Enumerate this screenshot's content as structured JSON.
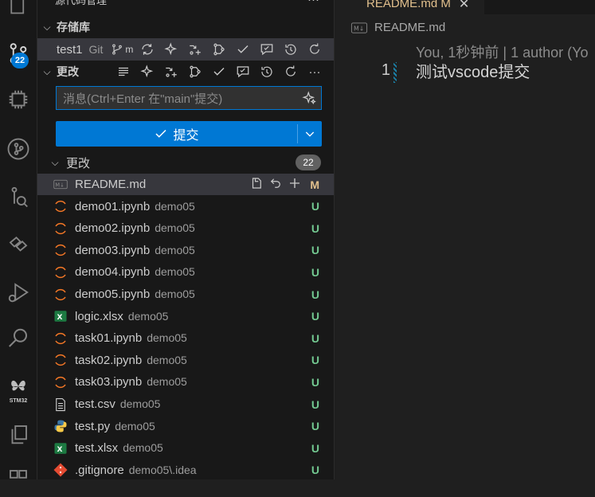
{
  "sidebar": {
    "top_title": "源代码管理",
    "repos_header": "存储库",
    "repo": {
      "name": "test1",
      "type": "Git",
      "branch": "m"
    },
    "changes_section": "更改",
    "commit_input": {
      "placeholder": "消息(Ctrl+Enter 在\"main\"提交)",
      "value": ""
    },
    "commit_button": "提交",
    "changes_group": {
      "label": "更改",
      "count": "22"
    },
    "files": [
      {
        "name": "README.md",
        "dir": "",
        "status": "M",
        "icon": "markdown-icon"
      },
      {
        "name": "demo01.ipynb",
        "dir": "demo05",
        "status": "U",
        "icon": "jupyter-icon"
      },
      {
        "name": "demo02.ipynb",
        "dir": "demo05",
        "status": "U",
        "icon": "jupyter-icon"
      },
      {
        "name": "demo03.ipynb",
        "dir": "demo05",
        "status": "U",
        "icon": "jupyter-icon"
      },
      {
        "name": "demo04.ipynb",
        "dir": "demo05",
        "status": "U",
        "icon": "jupyter-icon"
      },
      {
        "name": "demo05.ipynb",
        "dir": "demo05",
        "status": "U",
        "icon": "jupyter-icon"
      },
      {
        "name": "logic.xlsx",
        "dir": "demo05",
        "status": "U",
        "icon": "excel-icon"
      },
      {
        "name": "task01.ipynb",
        "dir": "demo05",
        "status": "U",
        "icon": "jupyter-icon"
      },
      {
        "name": "task02.ipynb",
        "dir": "demo05",
        "status": "U",
        "icon": "jupyter-icon"
      },
      {
        "name": "task03.ipynb",
        "dir": "demo05",
        "status": "U",
        "icon": "jupyter-icon"
      },
      {
        "name": "test.csv",
        "dir": "demo05",
        "status": "U",
        "icon": "csv-icon"
      },
      {
        "name": "test.py",
        "dir": "demo05",
        "status": "U",
        "icon": "python-icon"
      },
      {
        "name": "test.xlsx",
        "dir": "demo05",
        "status": "U",
        "icon": "excel-icon"
      },
      {
        "name": ".gitignore",
        "dir": "demo05\\.idea",
        "status": "U",
        "icon": "git-icon"
      }
    ]
  },
  "activity": {
    "scm_badge": "22",
    "stm_label": "STM32"
  },
  "editor": {
    "tab_label": "README.md  M",
    "breadcrumb": "README.md",
    "codelens": "You, 1秒钟前 | 1 author (Yo",
    "line_number": "1",
    "line_text": "测试vscode提交"
  },
  "colors": {
    "accent": "#0078d4",
    "untracked": "#73c991",
    "modified": "#e2c08d"
  }
}
